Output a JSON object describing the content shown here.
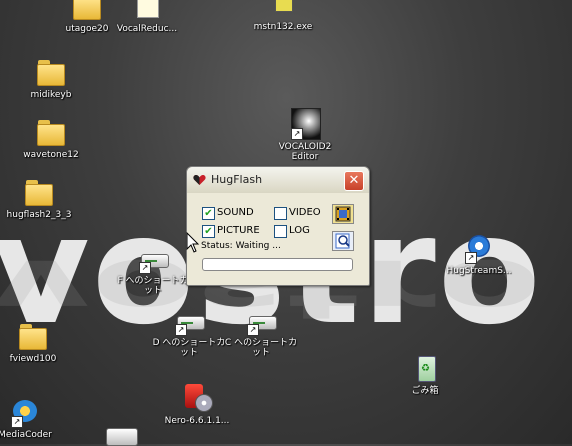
{
  "desktop": {
    "wallpaper_text": "vostro",
    "icons": [
      {
        "label": "utagoe20"
      },
      {
        "label": "VocalReduc..."
      },
      {
        "label": "mstn132.exe"
      },
      {
        "label": "midikeyb"
      },
      {
        "label": "wavetone12"
      },
      {
        "label": "VOCALOID2 Editor"
      },
      {
        "label": "hugflash2_3_3"
      },
      {
        "label": "F へのショートカット"
      },
      {
        "label": "HugStreamS..."
      },
      {
        "label": "D へのショートカット"
      },
      {
        "label": "C へのショートカット"
      },
      {
        "label": "fviewd100"
      },
      {
        "label": "ごみ箱"
      },
      {
        "label": "Nero-6.6.1.1..."
      },
      {
        "label": "MediaCoder"
      }
    ]
  },
  "window": {
    "title": "HugFlash",
    "close_glyph": "✕",
    "options": {
      "sound": {
        "label": "SOUND",
        "checked": true
      },
      "video": {
        "label": "VIDEO",
        "checked": false
      },
      "picture": {
        "label": "PICTURE",
        "checked": true
      },
      "log": {
        "label": "LOG",
        "checked": false
      }
    },
    "status_text": "Status: Waiting ...",
    "progress": 0
  },
  "colors": {
    "accent": "#c8412a",
    "folder": "#ffd45a",
    "check": "#21a121"
  }
}
